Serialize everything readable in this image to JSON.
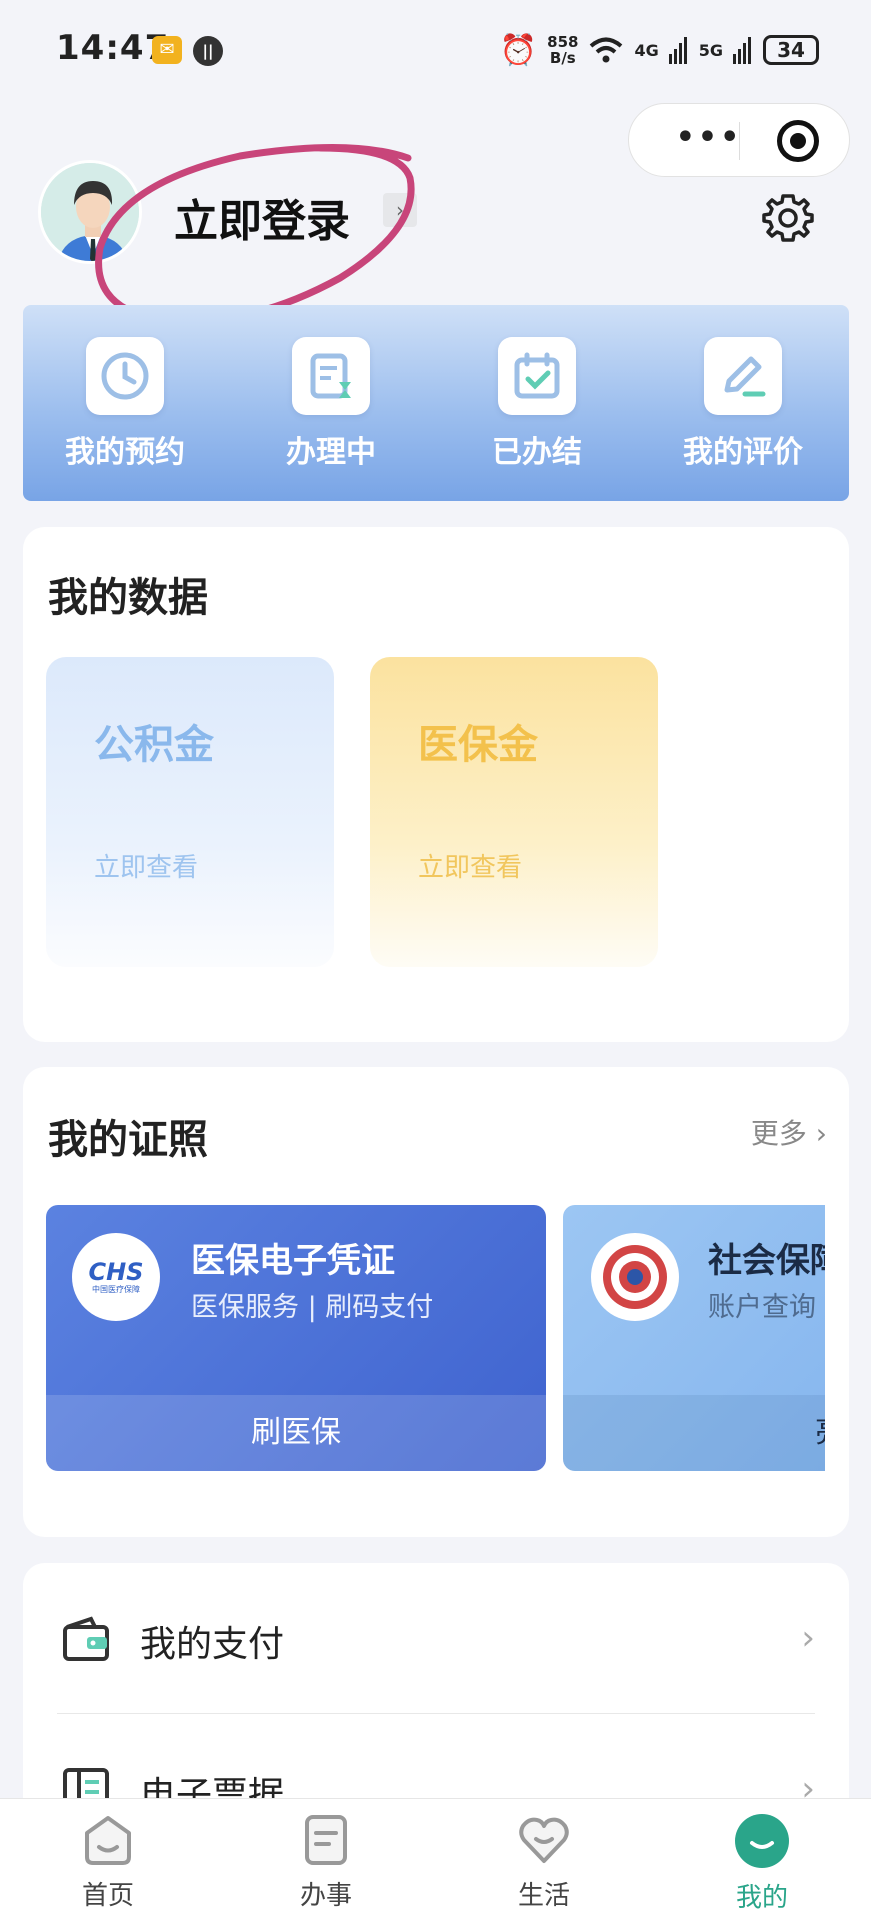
{
  "status": {
    "time": "14:47",
    "speed_top": "858",
    "speed_bottom": "B/s",
    "net1": "4G",
    "net2": "5G",
    "battery": "34"
  },
  "capsule": {
    "more": "•••"
  },
  "profile": {
    "login_text": "立即登录",
    "arrow": "›"
  },
  "banner": {
    "items": [
      {
        "label": "我的预约"
      },
      {
        "label": "办理中"
      },
      {
        "label": "已办结"
      },
      {
        "label": "我的评价"
      }
    ]
  },
  "my_data": {
    "title": "我的数据",
    "tiles": [
      {
        "name": "公积金",
        "link": "立即查看",
        "color": "#8ab8ec"
      },
      {
        "name": "医保金",
        "link": "立即查看",
        "color": "#f3c14c"
      }
    ]
  },
  "certs": {
    "title": "我的证照",
    "more": "更多",
    "items": [
      {
        "title": "医保电子凭证",
        "subtitle": "医保服务 | 刷码支付",
        "action": "刷医保",
        "logo_text": "CHS",
        "logo_sub": "中国医疗保障"
      },
      {
        "title": "社会保障卡",
        "subtitle": "账户查询",
        "action": "亮证"
      }
    ]
  },
  "menu": {
    "items": [
      {
        "label": "我的支付"
      },
      {
        "label": "电子票据"
      }
    ]
  },
  "tabbar": {
    "items": [
      {
        "label": "首页"
      },
      {
        "label": "办事"
      },
      {
        "label": "生活"
      },
      {
        "label": "我的"
      }
    ],
    "active_color": "#2aa58a"
  }
}
